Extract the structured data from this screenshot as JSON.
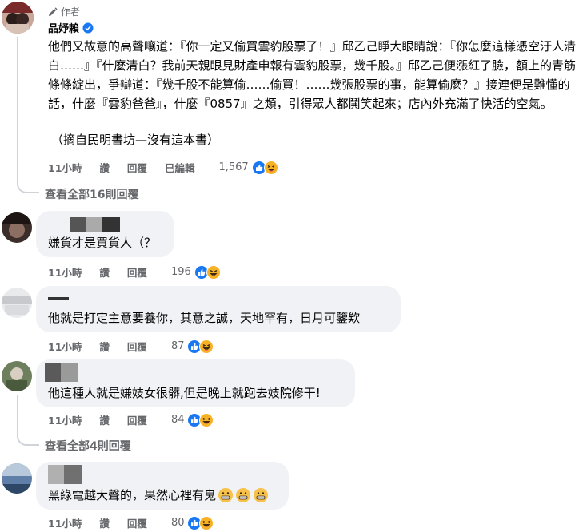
{
  "comments": [
    {
      "author_badge": "作者",
      "author": "品妤賴",
      "text": "他們又故意的高聲嚷道：『你一定又偷買雲豹股票了！』邱乙己睜大眼睛說：『你怎麼這樣憑空汙人清白……』『什麼清白？我前天親眼見財產申報有雲豹股票，幾千股。』邱乙己便漲紅了臉，額上的青筋條條綻出，爭辯道：『幾千股不能算偷……偷買！……幾張股票的事，能算偷麼？』接連便是難懂的話，什麼『雲豹爸爸』，什麼『0857』之類，引得眾人都鬨笑起來；店內外充滿了快活的空氣。",
      "quote": "（摘自民明書坊—沒有這本書）",
      "time": "11小時",
      "like": "讚",
      "reply": "回覆",
      "edited": "已編輯",
      "reactions": "1,567",
      "view_replies": "查看全部16則回覆"
    },
    {
      "text": "嫌貨才是買貨人（？",
      "time": "11小時",
      "like": "讚",
      "reply": "回覆",
      "reactions": "196"
    },
    {
      "text": "他就是打定主意要養你，其意之誠，天地罕有，日月可鑒欸",
      "time": "11小時",
      "like": "讚",
      "reply": "回覆",
      "reactions": "87"
    },
    {
      "text": "他這種人就是嫌妓女很髒,但是晚上就跑去妓院修干!",
      "time": "11小時",
      "like": "讚",
      "reply": "回覆",
      "reactions": "84",
      "view_replies": "查看全部4則回覆"
    },
    {
      "text": "黑綠電越大聲的，果然心裡有鬼",
      "time": "11小時",
      "like": "讚",
      "reply": "回覆",
      "reactions": "80"
    }
  ],
  "colors": {
    "like_blue": "#1877f2",
    "verified_blue": "#1877f2",
    "haha_yellow": "#f7b125",
    "bubble_bg": "#f0f2f5",
    "meta_gray": "#65676b"
  }
}
